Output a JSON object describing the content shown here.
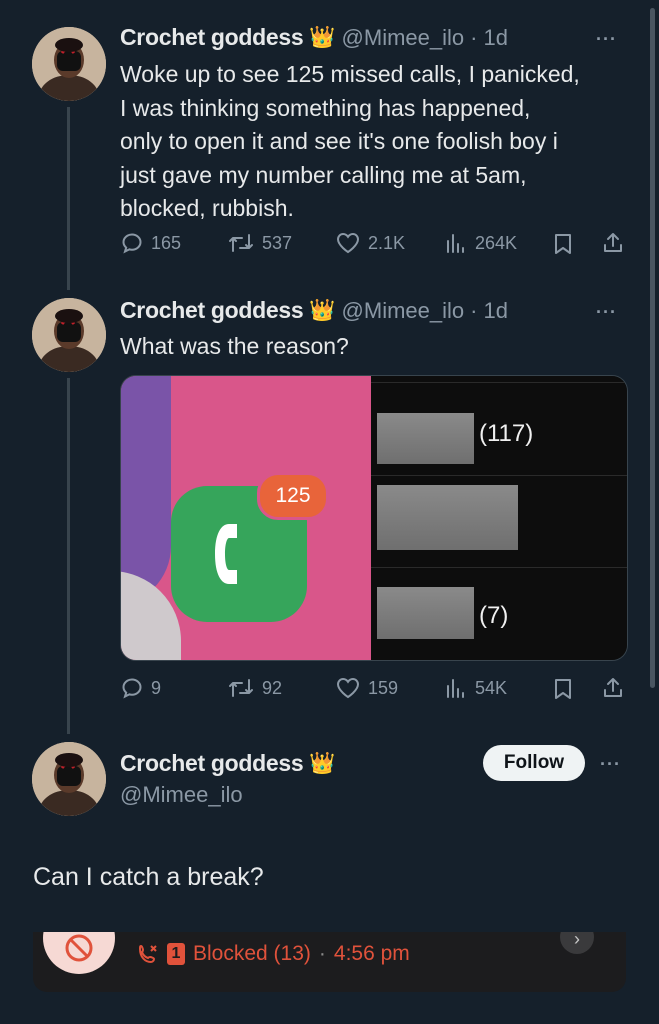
{
  "tweets": [
    {
      "name": "Crochet goddess",
      "handle": "@Mimee_ilo",
      "time": "1d",
      "lines": [
        "Woke up to see 125 missed calls, I panicked,",
        "I was thinking something has happened,",
        "only to open it and see it's one foolish boy i",
        "just gave my number calling me at 5am,",
        "blocked, rubbish."
      ],
      "replies": "165",
      "retweets": "537",
      "likes": "2.1K",
      "views": "264K"
    },
    {
      "name": "Crochet goddess",
      "handle": "@Mimee_ilo",
      "time": "1d",
      "text": "What was the reason?",
      "media": {
        "badge_count": "125",
        "bar_labels": [
          "(117)",
          "(7)"
        ]
      },
      "replies": "9",
      "retweets": "92",
      "likes": "159",
      "views": "54K"
    }
  ],
  "main": {
    "name": "Crochet goddess",
    "handle": "@Mimee_ilo",
    "follow_label": "Follow",
    "text": "Can I catch a break?",
    "media": {
      "blocked_count_icon": "1",
      "blocked_label": "Blocked (13)",
      "separator": "·",
      "time": "4:56 pm"
    }
  },
  "icons": {
    "crown": "crown-emoji",
    "reply": "reply-icon",
    "retweet": "retweet-icon",
    "like": "heart-icon",
    "views": "views-icon",
    "bookmark": "bookmark-icon",
    "share": "share-icon"
  },
  "colors": {
    "background": "#15202b",
    "text": "#e7e9ea",
    "secondary": "#8b98a5",
    "blocked_red": "#e0523b",
    "phone_green": "#36a55b",
    "badge_orange": "#e8643a"
  }
}
